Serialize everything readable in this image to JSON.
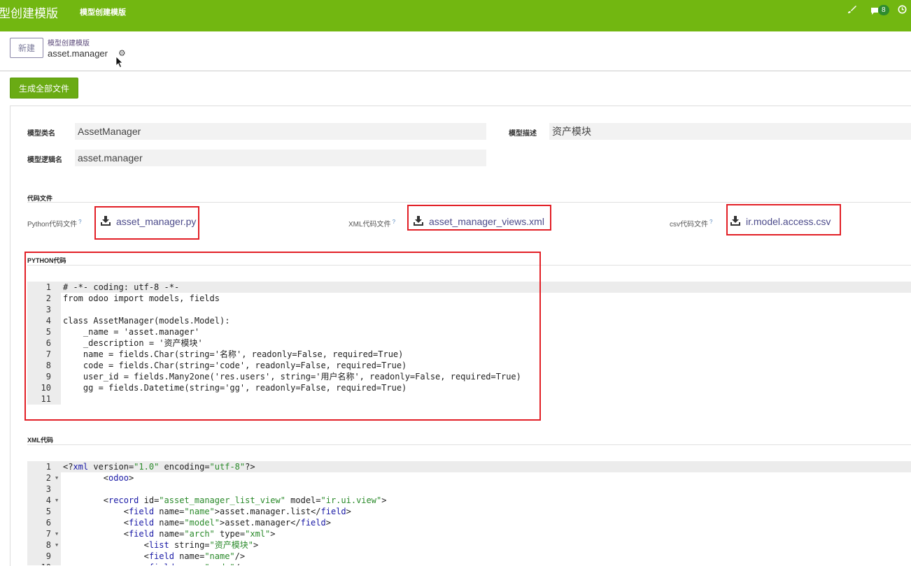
{
  "topbar": {
    "app_title": "型创建模版",
    "menu_item": "模型创建模版",
    "notification_count": "8",
    "icons": [
      "brush-icon",
      "chat-icon",
      "clock-icon"
    ]
  },
  "control_panel": {
    "new_button": "新建",
    "breadcrumb_parent": "模型创建模版",
    "breadcrumb_current": "asset.manager",
    "generate_button": "生成全部文件"
  },
  "form": {
    "model_class_label": "模型类名",
    "model_class_value": "AssetManager",
    "model_desc_label": "模型描述",
    "model_desc_value": "资产模块",
    "model_logic_label": "模型逻辑名",
    "model_logic_value": "asset.manager"
  },
  "files": {
    "section_title": "代码文件",
    "python_label": "Python代码文件",
    "python_file": "asset_manager.py",
    "xml_label": "XML代码文件",
    "xml_file": "asset_manager_views.xml",
    "csv_label": "csv代码文件",
    "csv_file": "ir.model.access.csv",
    "help_mark": "?"
  },
  "python_code": {
    "section_title": "PYTHON代码",
    "lines": [
      "# -*- coding: utf-8 -*-",
      "from odoo import models, fields",
      "",
      "class AssetManager(models.Model):",
      "    _name = 'asset.manager'",
      "    _description = '资产模块'",
      "    name = fields.Char(string='名称', readonly=False, required=True)",
      "    code = fields.Char(string='code', readonly=False, required=True)",
      "    user_id = fields.Many2one('res.users', string='用户名称', readonly=False, required=True)",
      "    gg = fields.Datetime(string='gg', readonly=False, required=True)",
      ""
    ]
  },
  "xml_code": {
    "section_title": "XML代码",
    "lines": [
      "<?xml version=\"1.0\" encoding=\"utf-8\"?>",
      "        <odoo>",
      "",
      "        <record id=\"asset_manager_list_view\" model=\"ir.ui.view\">",
      "            <field name=\"name\">asset.manager.list</field>",
      "            <field name=\"model\">asset.manager</field>",
      "            <field name=\"arch\" type=\"xml\">",
      "                <list string=\"资产模块\">",
      "                <field name=\"name\"/>",
      "                <field name=\"code\"/>"
    ],
    "folds": [
      false,
      true,
      false,
      true,
      false,
      false,
      true,
      true,
      false,
      false
    ]
  }
}
